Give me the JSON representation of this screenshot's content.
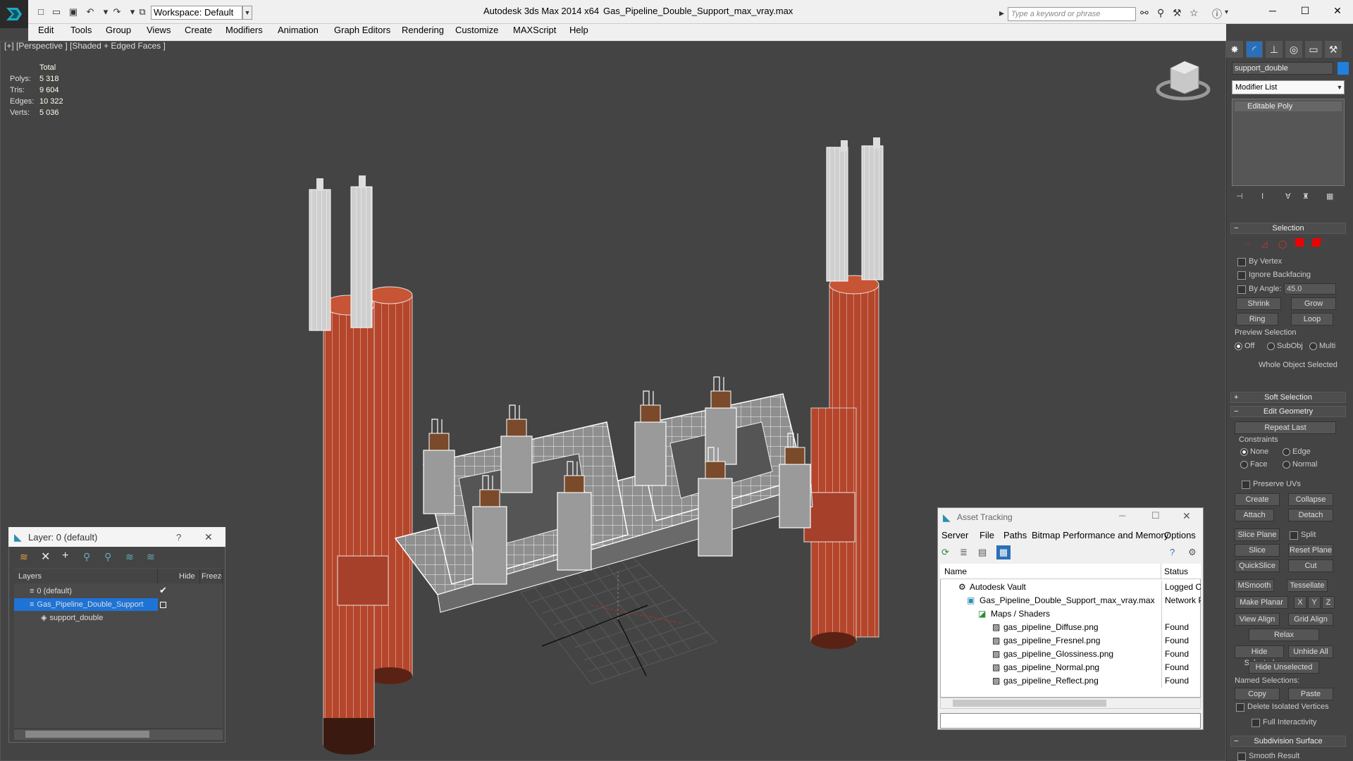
{
  "titlebar": {
    "workspace": "Workspace: Default",
    "app_title": "Autodesk 3ds Max  2014 x64",
    "file_title": "Gas_Pipeline_Double_Support_max_vray.max",
    "search_placeholder": "Type a keyword or phrase"
  },
  "menu": [
    "Edit",
    "Tools",
    "Group",
    "Views",
    "Create",
    "Modifiers",
    "Animation",
    "Graph Editors",
    "Rendering",
    "Customize",
    "MAXScript",
    "Help"
  ],
  "viewport": {
    "label": "[+] [Perspective ] [Shaded + Edged Faces ]",
    "stats_header": "Total",
    "stats": [
      {
        "label": "Polys:",
        "value": "5 318"
      },
      {
        "label": "Tris:",
        "value": "9 604"
      },
      {
        "label": "Edges:",
        "value": "10 322"
      },
      {
        "label": "Verts:",
        "value": "5 036"
      }
    ]
  },
  "command_panel": {
    "object_name": "support_double",
    "modifier_list": "Modifier List",
    "stack_item": "Editable Poly",
    "selection_title": "Selection",
    "by_vertex": "By Vertex",
    "ignore_backfacing": "Ignore Backfacing",
    "by_angle": "By Angle:",
    "angle_value": "45.0",
    "shrink": "Shrink",
    "grow": "Grow",
    "ring": "Ring",
    "loop": "Loop",
    "preview_selection": "Preview Selection",
    "preview_off": "Off",
    "preview_subobj": "SubObj",
    "preview_multi": "Multi",
    "whole_object": "Whole Object Selected",
    "soft_selection": "Soft Selection",
    "edit_geometry": "Edit Geometry",
    "repeat_last": "Repeat Last",
    "constraints": "Constraints",
    "c_none": "None",
    "c_edge": "Edge",
    "c_face": "Face",
    "c_normal": "Normal",
    "preserve_uvs": "Preserve UVs",
    "create": "Create",
    "collapse": "Collapse",
    "attach": "Attach",
    "detach": "Detach",
    "slice_plane": "Slice Plane",
    "split": "Split",
    "slice": "Slice",
    "reset_plane": "Reset Plane",
    "quickslice": "QuickSlice",
    "cut": "Cut",
    "msmooth": "MSmooth",
    "tessellate": "Tessellate",
    "make_planar": "Make Planar",
    "x": "X",
    "y": "Y",
    "z": "Z",
    "view_align": "View Align",
    "grid_align": "Grid Align",
    "relax": "Relax",
    "hide_selected": "Hide Selected",
    "unhide_all": "Unhide All",
    "hide_unselected": "Hide Unselected",
    "named_selections": "Named Selections:",
    "copy": "Copy",
    "paste": "Paste",
    "delete_isolated": "Delete Isolated Vertices",
    "full_interactivity": "Full Interactivity",
    "subdivision_surface": "Subdivision Surface",
    "smooth_result": "Smooth Result"
  },
  "layer_explorer": {
    "title": "Layer: 0 (default)",
    "help": "?",
    "close": "✕",
    "col_layers": "Layers",
    "col_hide": "Hide",
    "col_freeze": "Freeze",
    "rows": [
      "0 (default)",
      "Gas_Pipeline_Double_Support",
      "support_double"
    ]
  },
  "asset_tracking": {
    "title": "Asset Tracking",
    "menus": [
      "Server",
      "File",
      "Paths",
      "Bitmap Performance and Memory",
      "Options"
    ],
    "col_name": "Name",
    "col_status": "Status",
    "rows": [
      {
        "name": "Autodesk Vault",
        "status": "Logged Out"
      },
      {
        "name": "Gas_Pipeline_Double_Support_max_vray.max",
        "status": "Network P"
      },
      {
        "name": "Maps / Shaders",
        "status": ""
      },
      {
        "name": "gas_pipeline_Diffuse.png",
        "status": "Found"
      },
      {
        "name": "gas_pipeline_Fresnel.png",
        "status": "Found"
      },
      {
        "name": "gas_pipeline_Glossiness.png",
        "status": "Found"
      },
      {
        "name": "gas_pipeline_Normal.png",
        "status": "Found"
      },
      {
        "name": "gas_pipeline_Reflect.png",
        "status": "Found"
      }
    ]
  },
  "colors": {
    "pipe_red": "#b5462b",
    "selection_blue": "#1e73d6",
    "viewport_bg": "#444444"
  }
}
